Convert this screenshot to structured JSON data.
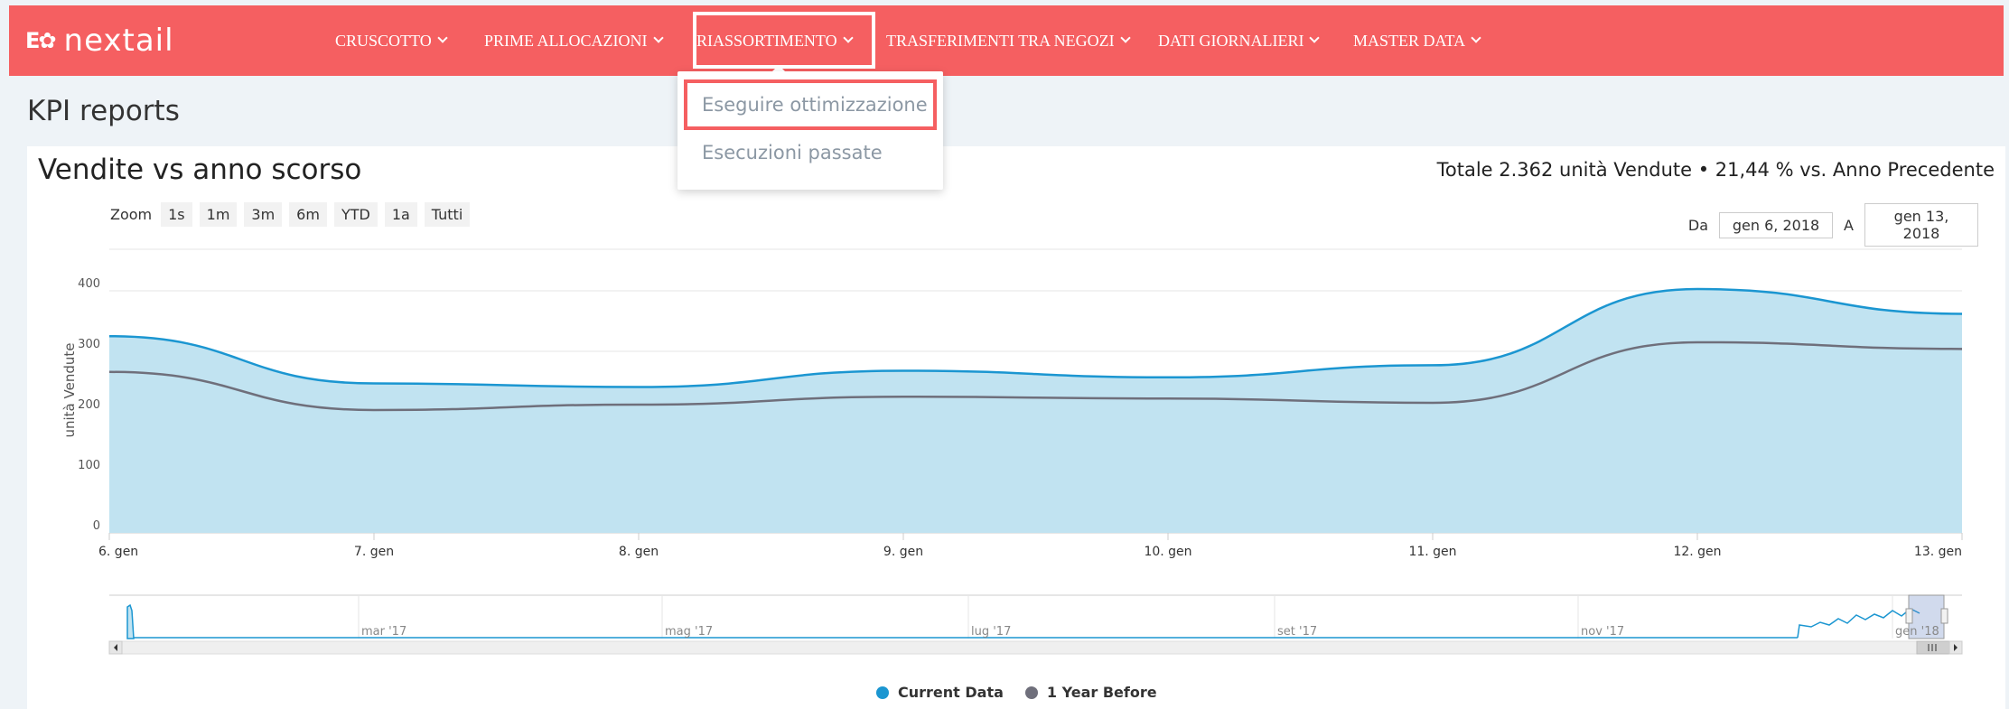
{
  "brand": {
    "logo_mark": "E✿",
    "logo_text": "nextail"
  },
  "nav": {
    "items": [
      {
        "label": "CRUSCOTTO"
      },
      {
        "label": "PRIME ALLOCAZIONI"
      },
      {
        "label": "RIASSORTIMENTO"
      },
      {
        "label": "TRASFERIMENTI TRA NEGOZI"
      },
      {
        "label": "DATI GIORNALIERI"
      },
      {
        "label": "MASTER DATA"
      }
    ],
    "active_index": 2
  },
  "dropdown": {
    "items": [
      {
        "label": "Eseguire ottimizzazione",
        "highlighted": true
      },
      {
        "label": "Esecuzioni passate",
        "highlighted": false
      }
    ]
  },
  "page": {
    "title": "KPI reports"
  },
  "chart_card": {
    "title": "Vendite vs anno scorso",
    "total": "Totale 2.362 unità Vendute • 21,44 % vs. Anno Precedente",
    "zoom_label": "Zoom",
    "zoom_buttons": [
      "1s",
      "1m",
      "3m",
      "6m",
      "YTD",
      "1a",
      "Tutti"
    ],
    "from_label": "Da",
    "from_value": "gen 6, 2018",
    "to_label": "A",
    "to_value": "gen 13, 2018",
    "navigator_labels": [
      "mar '17",
      "mag '17",
      "lug '17",
      "set '17",
      "nov '17",
      "gen '18"
    ]
  },
  "colors": {
    "brand_red": "#f55f61",
    "current_line": "#1b96d1",
    "current_fill": "#c1e3f1",
    "previous_line": "#6f6f7b",
    "grid": "#e6e6e6"
  },
  "chart_data": {
    "type": "area",
    "ylabel": "unità Vendute",
    "ylim": [
      0,
      400
    ],
    "yticks": [
      0,
      100,
      200,
      300,
      400
    ],
    "x": [
      "6. gen",
      "7. gen",
      "8. gen",
      "9. gen",
      "10. gen",
      "11. gen",
      "12. gen",
      "13. gen"
    ],
    "series": [
      {
        "name": "Current Data",
        "values": [
          325,
          247,
          241,
          268,
          257,
          277,
          403,
          362
        ]
      },
      {
        "name": "1 Year Before",
        "values": [
          266,
          203,
          212,
          225,
          222,
          215,
          315,
          304
        ]
      }
    ],
    "legend_position": "bottom-center"
  }
}
